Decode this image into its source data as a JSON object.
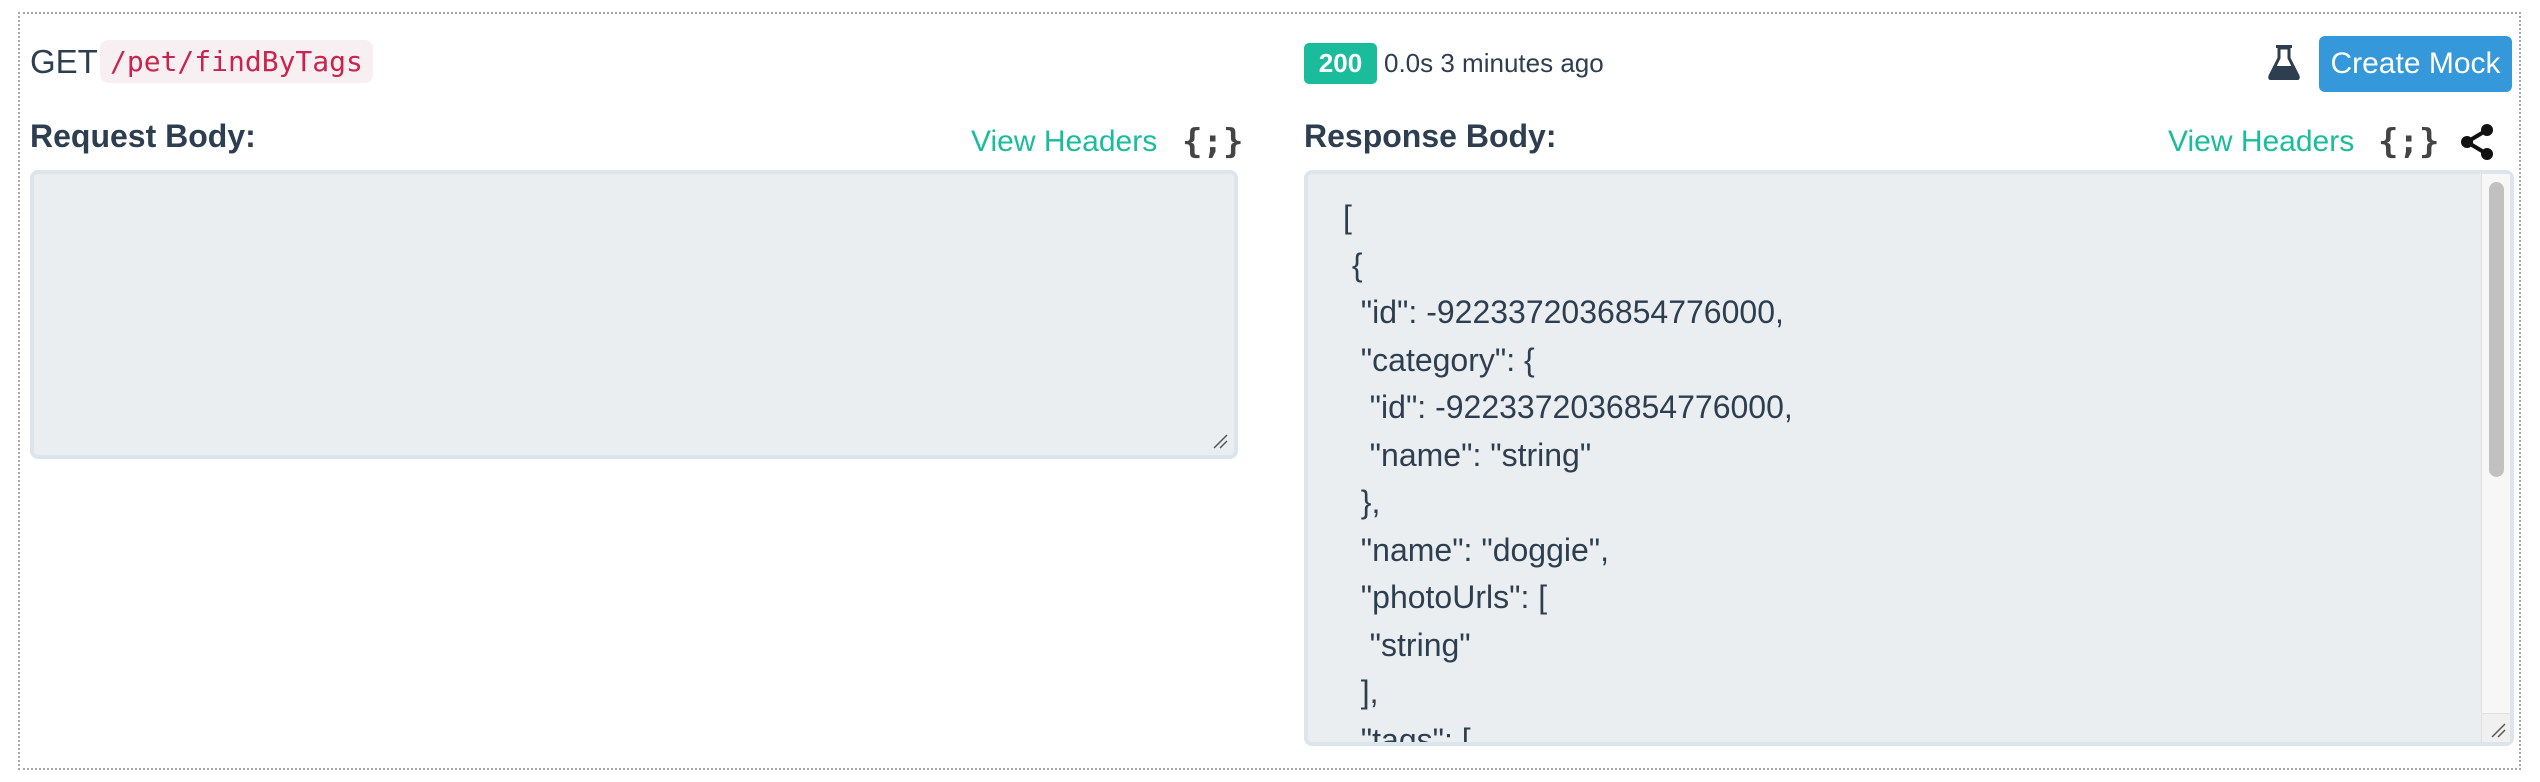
{
  "request": {
    "method": "GET",
    "path": "/pet/findByTags"
  },
  "response_status": {
    "code": "200",
    "meta": "0.0s 3 minutes ago",
    "badge_color": "#1abc9c"
  },
  "toolbar": {
    "flask_icon": "flask-icon",
    "create_mock_label": "Create Mock",
    "create_mock_color": "#3498db"
  },
  "request_panel": {
    "title": "Request Body:",
    "view_headers_label": "View Headers",
    "format_icon": "{;}",
    "body_value": ""
  },
  "response_panel": {
    "title": "Response Body:",
    "view_headers_label": "View Headers",
    "format_icon": "{;}",
    "share_icon": "share-icon",
    "body_lines": [
      "[",
      " {",
      "  \"id\": -9223372036854776000,",
      "  \"category\": {",
      "   \"id\": -9223372036854776000,",
      "   \"name\": \"string\"",
      "  },",
      "  \"name\": \"doggie\",",
      "  \"photoUrls\": [",
      "   \"string\"",
      "  ],",
      "  \"tags\": ["
    ]
  },
  "colors": {
    "link": "#1abc9c",
    "text": "#2c3e50",
    "path_text": "#c7254e",
    "path_bg": "#f8eff2",
    "body_bg": "#ebeef0"
  }
}
